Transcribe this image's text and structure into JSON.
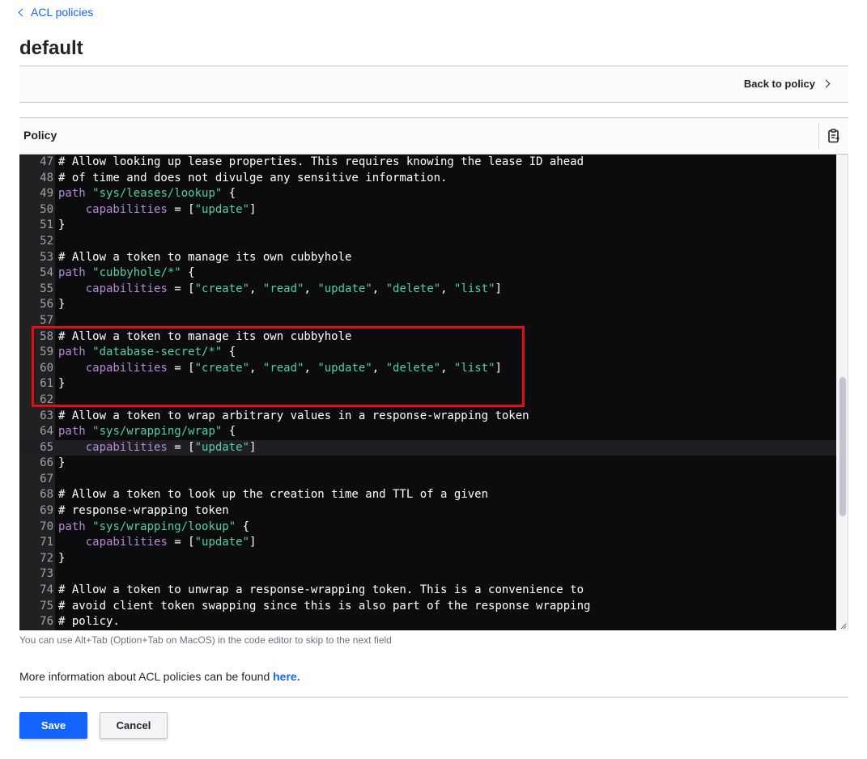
{
  "breadcrumb": {
    "label": "ACL policies"
  },
  "page_title": "default",
  "toolbar": {
    "back_label": "Back to policy"
  },
  "policy_section": {
    "label": "Policy",
    "copy_icon": "clipboard-icon"
  },
  "editor": {
    "active_line": 65,
    "lines": [
      {
        "n": "47",
        "tokens": [
          {
            "t": "# Allow looking up lease properties. This requires knowing the lease ID ahead",
            "c": "com"
          }
        ]
      },
      {
        "n": "48",
        "tokens": [
          {
            "t": "# of time and does not divulge any sensitive information.",
            "c": "com"
          }
        ]
      },
      {
        "n": "49",
        "tokens": [
          {
            "t": "path",
            "c": "kw"
          },
          {
            "t": " ",
            "c": "plain"
          },
          {
            "t": "\"sys/leases/lookup\"",
            "c": "str"
          },
          {
            "t": " {",
            "c": "plain"
          }
        ]
      },
      {
        "n": "50",
        "tokens": [
          {
            "t": "    ",
            "c": "plain"
          },
          {
            "t": "capabilities",
            "c": "kw"
          },
          {
            "t": " = [",
            "c": "plain"
          },
          {
            "t": "\"update\"",
            "c": "str"
          },
          {
            "t": "]",
            "c": "plain"
          }
        ]
      },
      {
        "n": "51",
        "tokens": [
          {
            "t": "}",
            "c": "plain"
          }
        ]
      },
      {
        "n": "52",
        "tokens": []
      },
      {
        "n": "53",
        "tokens": [
          {
            "t": "# Allow a token to manage its own cubbyhole",
            "c": "com"
          }
        ]
      },
      {
        "n": "54",
        "tokens": [
          {
            "t": "path",
            "c": "kw"
          },
          {
            "t": " ",
            "c": "plain"
          },
          {
            "t": "\"cubbyhole/*\"",
            "c": "str"
          },
          {
            "t": " {",
            "c": "plain"
          }
        ]
      },
      {
        "n": "55",
        "tokens": [
          {
            "t": "    ",
            "c": "plain"
          },
          {
            "t": "capabilities",
            "c": "kw"
          },
          {
            "t": " = [",
            "c": "plain"
          },
          {
            "t": "\"create\"",
            "c": "str"
          },
          {
            "t": ", ",
            "c": "plain"
          },
          {
            "t": "\"read\"",
            "c": "str"
          },
          {
            "t": ", ",
            "c": "plain"
          },
          {
            "t": "\"update\"",
            "c": "str"
          },
          {
            "t": ", ",
            "c": "plain"
          },
          {
            "t": "\"delete\"",
            "c": "str"
          },
          {
            "t": ", ",
            "c": "plain"
          },
          {
            "t": "\"list\"",
            "c": "str"
          },
          {
            "t": "]",
            "c": "plain"
          }
        ]
      },
      {
        "n": "56",
        "tokens": [
          {
            "t": "}",
            "c": "plain"
          }
        ]
      },
      {
        "n": "57",
        "tokens": []
      },
      {
        "n": "58",
        "tokens": [
          {
            "t": "# Allow a token to manage its own cubbyhole",
            "c": "com"
          }
        ]
      },
      {
        "n": "59",
        "tokens": [
          {
            "t": "path",
            "c": "kw"
          },
          {
            "t": " ",
            "c": "plain"
          },
          {
            "t": "\"database-secret/*\"",
            "c": "str"
          },
          {
            "t": " {",
            "c": "plain"
          }
        ]
      },
      {
        "n": "60",
        "tokens": [
          {
            "t": "    ",
            "c": "plain"
          },
          {
            "t": "capabilities",
            "c": "kw"
          },
          {
            "t": " = [",
            "c": "plain"
          },
          {
            "t": "\"create\"",
            "c": "str"
          },
          {
            "t": ", ",
            "c": "plain"
          },
          {
            "t": "\"read\"",
            "c": "str"
          },
          {
            "t": ", ",
            "c": "plain"
          },
          {
            "t": "\"update\"",
            "c": "str"
          },
          {
            "t": ", ",
            "c": "plain"
          },
          {
            "t": "\"delete\"",
            "c": "str"
          },
          {
            "t": ", ",
            "c": "plain"
          },
          {
            "t": "\"list\"",
            "c": "str"
          },
          {
            "t": "]",
            "c": "plain"
          }
        ]
      },
      {
        "n": "61",
        "tokens": [
          {
            "t": "}",
            "c": "plain"
          }
        ]
      },
      {
        "n": "62",
        "tokens": []
      },
      {
        "n": "63",
        "tokens": [
          {
            "t": "# Allow a token to wrap arbitrary values in a response-wrapping token",
            "c": "com"
          }
        ]
      },
      {
        "n": "64",
        "tokens": [
          {
            "t": "path",
            "c": "kw"
          },
          {
            "t": " ",
            "c": "plain"
          },
          {
            "t": "\"sys/wrapping/wrap\"",
            "c": "str"
          },
          {
            "t": " {",
            "c": "plain"
          }
        ]
      },
      {
        "n": "65",
        "tokens": [
          {
            "t": "    ",
            "c": "plain"
          },
          {
            "t": "capabilities",
            "c": "kw"
          },
          {
            "t": " = [",
            "c": "plain"
          },
          {
            "t": "\"update\"",
            "c": "str"
          },
          {
            "t": "]",
            "c": "plain"
          }
        ]
      },
      {
        "n": "66",
        "tokens": [
          {
            "t": "}",
            "c": "plain"
          }
        ]
      },
      {
        "n": "67",
        "tokens": []
      },
      {
        "n": "68",
        "tokens": [
          {
            "t": "# Allow a token to look up the creation time and TTL of a given",
            "c": "com"
          }
        ]
      },
      {
        "n": "69",
        "tokens": [
          {
            "t": "# response-wrapping token",
            "c": "com"
          }
        ]
      },
      {
        "n": "70",
        "tokens": [
          {
            "t": "path",
            "c": "kw"
          },
          {
            "t": " ",
            "c": "plain"
          },
          {
            "t": "\"sys/wrapping/lookup\"",
            "c": "str"
          },
          {
            "t": " {",
            "c": "plain"
          }
        ]
      },
      {
        "n": "71",
        "tokens": [
          {
            "t": "    ",
            "c": "plain"
          },
          {
            "t": "capabilities",
            "c": "kw"
          },
          {
            "t": " = [",
            "c": "plain"
          },
          {
            "t": "\"update\"",
            "c": "str"
          },
          {
            "t": "]",
            "c": "plain"
          }
        ]
      },
      {
        "n": "72",
        "tokens": [
          {
            "t": "}",
            "c": "plain"
          }
        ]
      },
      {
        "n": "73",
        "tokens": []
      },
      {
        "n": "74",
        "tokens": [
          {
            "t": "# Allow a token to unwrap a response-wrapping token. This is a convenience to",
            "c": "com"
          }
        ]
      },
      {
        "n": "75",
        "tokens": [
          {
            "t": "# avoid client token swapping since this is also part of the response wrapping",
            "c": "com"
          }
        ]
      },
      {
        "n": "76",
        "tokens": [
          {
            "t": "# policy.",
            "c": "com"
          }
        ]
      }
    ]
  },
  "hint": "You can use Alt+Tab (Option+Tab on MacOS) in the code editor to skip to the next field",
  "more_info": {
    "text": "More information about ACL policies can be found ",
    "link": "here."
  },
  "buttons": {
    "save": "Save",
    "cancel": "Cancel"
  },
  "colors": {
    "accent": "#1563ff",
    "highlight_box": "#e10f14",
    "editor_bg": "#0c0c0e",
    "keyword": "#b58bd6",
    "string": "#4fd1a3"
  }
}
